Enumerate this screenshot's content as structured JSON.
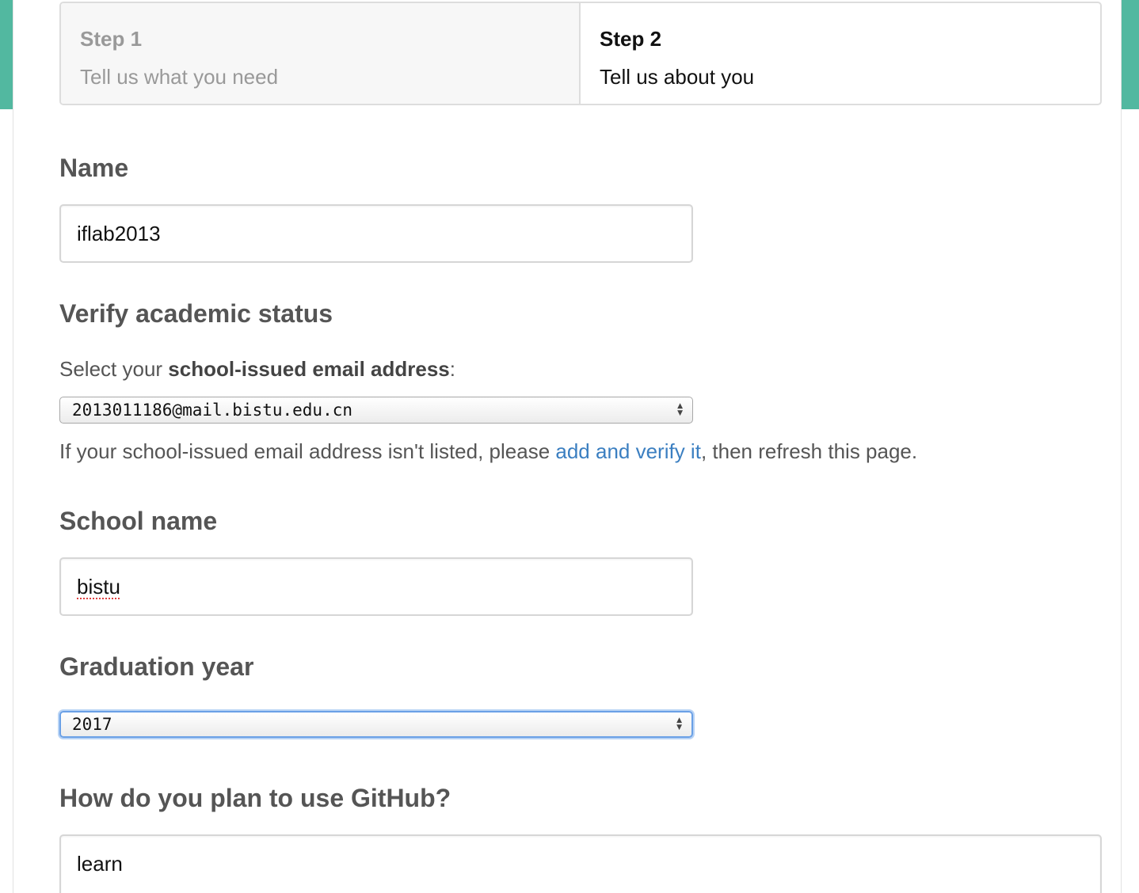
{
  "steps": [
    {
      "title": "Step 1",
      "description": "Tell us what you need"
    },
    {
      "title": "Step 2",
      "description": "Tell us about you"
    }
  ],
  "form": {
    "name": {
      "label": "Name",
      "value": "iflab2013"
    },
    "academic": {
      "label": "Verify academic status",
      "prompt_prefix": "Select your ",
      "prompt_bold": "school-issued email address",
      "prompt_suffix": ":",
      "selected_email": "2013011186@mail.bistu.edu.cn",
      "help_prefix": "If your school-issued email address isn't listed, please ",
      "help_link": "add and verify it",
      "help_suffix": ", then refresh this page."
    },
    "school": {
      "label": "School name",
      "value": "bistu"
    },
    "graduation": {
      "label": "Graduation year",
      "selected": "2017"
    },
    "usage": {
      "label": "How do you plan to use GitHub?",
      "value": "learn"
    }
  },
  "colors": {
    "accent": "#52b8a0",
    "link": "#3b7fc1",
    "focus_ring": "#6aa0e6"
  }
}
